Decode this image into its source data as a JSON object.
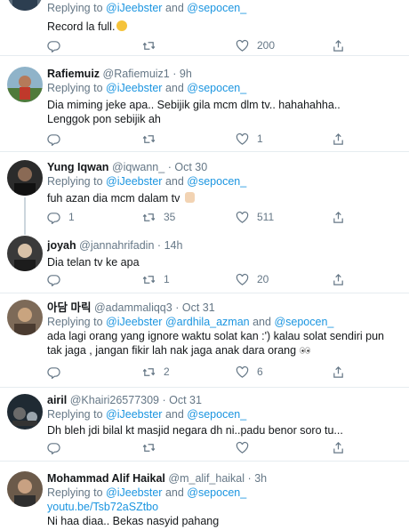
{
  "tweets": [
    {
      "replying_label": "Replying to",
      "mentions": [
        "@iJeebster",
        "@sepocen_"
      ],
      "and_label": "and",
      "text": "Record la full.",
      "reply_count": "",
      "retweet_count": "",
      "like_count": "200"
    },
    {
      "display_name": "Rafiemuiz",
      "handle": "@Rafiemuiz1",
      "time": "9h",
      "replying_label": "Replying to",
      "mentions": [
        "@iJeebster",
        "@sepocen_"
      ],
      "and_label": "and",
      "text": "Dia miming jeke apa.. Sebijik gila mcm dlm tv.. hahahahha.. Lenggok pon sebijik ah",
      "reply_count": "",
      "retweet_count": "",
      "like_count": "1"
    },
    {
      "display_name": "Yung Iqwan",
      "handle": "@iqwann_",
      "time": "Oct 30",
      "replying_label": "Replying to",
      "mentions": [
        "@iJeebster",
        "@sepocen_"
      ],
      "and_label": "and",
      "text": "fuh azan dia mcm dalam tv",
      "reply_count": "1",
      "retweet_count": "35",
      "like_count": "511"
    },
    {
      "display_name": "joyah",
      "handle": "@jannahrifadin",
      "time": "14h",
      "text": "Dia telan tv ke apa",
      "reply_count": "",
      "retweet_count": "1",
      "like_count": "20"
    },
    {
      "display_name": "아담 마릭",
      "handle": "@adammaliqq3",
      "time": "Oct 31",
      "replying_label": "Replying to",
      "mentions": [
        "@iJeebster",
        "@ardhila_azman",
        "@sepocen_"
      ],
      "and_label": "and",
      "text": "ada lagi orang yang ignore waktu solat kan :') kalau solat sendiri pun tak jaga , jangan fikir lah nak jaga anak dara orang",
      "reply_count": "",
      "retweet_count": "2",
      "like_count": "6"
    },
    {
      "display_name": "airil",
      "handle": "@Khairi26577309",
      "time": "Oct 31",
      "replying_label": "Replying to",
      "mentions": [
        "@iJeebster",
        "@sepocen_"
      ],
      "and_label": "and",
      "text": "Dh bleh jdi bilal kt masjid negara dh ni..padu benor soro tu...",
      "reply_count": "",
      "retweet_count": "",
      "like_count": ""
    },
    {
      "display_name": "Mohammad Alif Haikal",
      "handle": "@m_alif_haikal",
      "time": "3h",
      "replying_label": "Replying to",
      "mentions": [
        "@iJeebster",
        "@sepocen_"
      ],
      "and_label": "and",
      "link": "youtu.be/Tsb72aSZtbo",
      "text": "Ni haa diaa.. Bekas nasyid pahang"
    }
  ],
  "separator": "·",
  "colors": {
    "link": "#1b95e0",
    "muted": "#657786",
    "divider": "#e6ecf0",
    "thread_line": "#ccd6dd"
  },
  "icons": {
    "reply": "reply-icon",
    "retweet": "retweet-icon",
    "like": "heart-icon",
    "share": "share-icon"
  }
}
